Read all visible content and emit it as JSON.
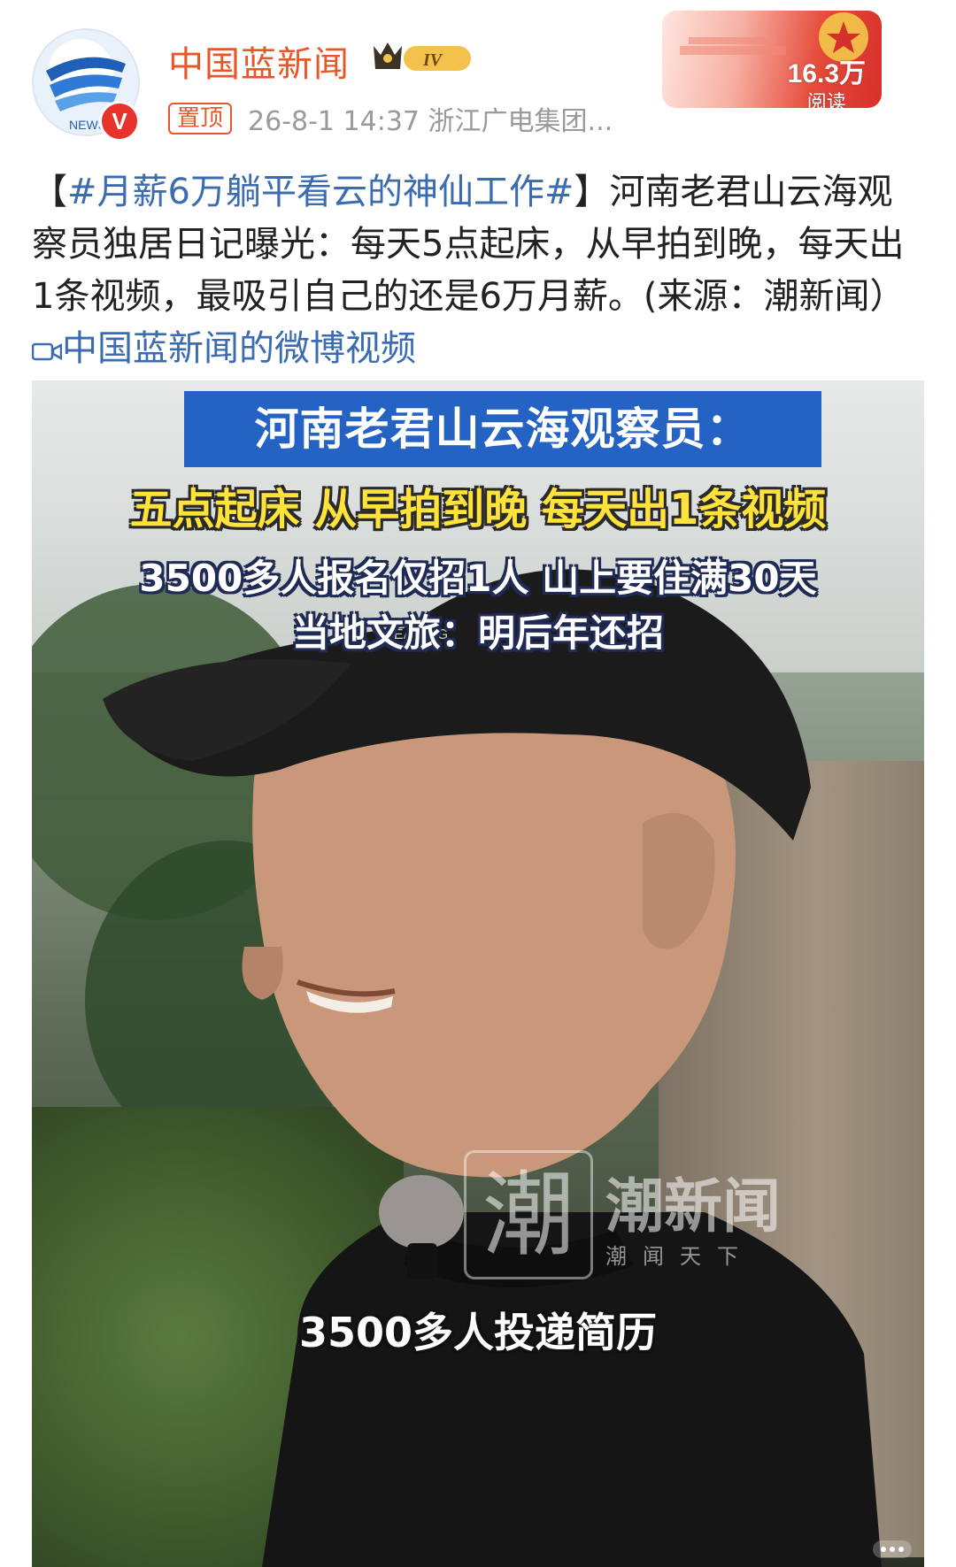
{
  "account": {
    "name": "中国蓝新闻",
    "level_badge": "IV",
    "avatar_badge": "V",
    "pinned_label": "置顶",
    "meta": "26-8-1 14:37  浙江广电集团...",
    "reads_count": "16.3万",
    "reads_label": "阅读"
  },
  "post": {
    "bracket_open": "【",
    "topic": "#月薪6万躺平看云的神仙工作#",
    "bracket_close": "】",
    "body": "河南老君山云海观察员独居日记曝光：每天5点起床，从早拍到晚，每天出1条视频，最吸引自己的还是6万月薪。(来源：潮新闻）",
    "video_link": "中国蓝新闻的微博视频"
  },
  "video": {
    "title_blue": "河南老君山云海观察员：",
    "title_yellow": "五点起床 从早拍到晚 每天出1条视频",
    "line1": "3500多人报名仅招1人 山上要住满30天",
    "line2": "当地文旅：明后年还招",
    "watermark_char": "潮",
    "watermark_name": "潮新闻",
    "watermark_sub": "潮闻天下",
    "subtitle": "3500多人投递简历",
    "cap_text": "LEADING"
  }
}
